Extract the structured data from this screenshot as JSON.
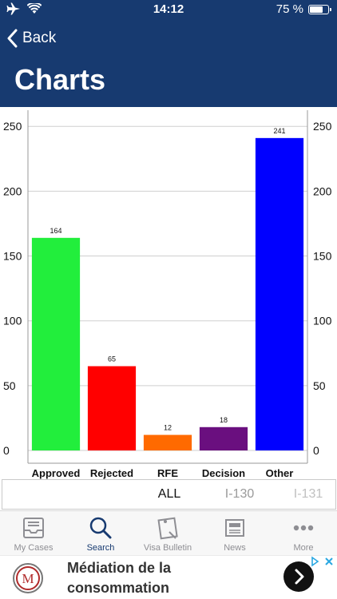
{
  "status": {
    "time": "14:12",
    "battery": "75 %",
    "battery_level": 0.75
  },
  "nav": {
    "back_label": "Back",
    "title": "Charts"
  },
  "chart_data": {
    "type": "bar",
    "categories": [
      "Approved",
      "Rejected",
      "RFE",
      "Decision",
      "Other"
    ],
    "values": [
      164,
      65,
      12,
      18,
      241
    ],
    "colors": [
      "#22ee3c",
      "#ff0000",
      "#ff6a00",
      "#6a0f7f",
      "#0000ff"
    ],
    "ylim": [
      0,
      260
    ],
    "yticks": [
      0,
      50,
      100,
      150,
      200,
      250
    ],
    "grid": true,
    "axes": "left-and-right",
    "title": "",
    "xlabel": "",
    "ylabel": ""
  },
  "filter": {
    "items": [
      "ALL",
      "I-130",
      "I-131"
    ],
    "selected": "ALL"
  },
  "tabbar": {
    "items": [
      {
        "label": "My Cases",
        "icon": "inbox-icon",
        "active": false
      },
      {
        "label": "Search",
        "icon": "search-icon",
        "active": true
      },
      {
        "label": "Visa Bulletin",
        "icon": "note-icon",
        "active": false
      },
      {
        "label": "News",
        "icon": "newspaper-icon",
        "active": false
      },
      {
        "label": "More",
        "icon": "more-icon",
        "active": false
      }
    ]
  },
  "ad": {
    "text": "Médiation de la consommation",
    "logo_letter": "M"
  },
  "colors": {
    "header": "#173a70",
    "active_tab": "#173a70",
    "inactive_tab": "#8e8e93"
  }
}
